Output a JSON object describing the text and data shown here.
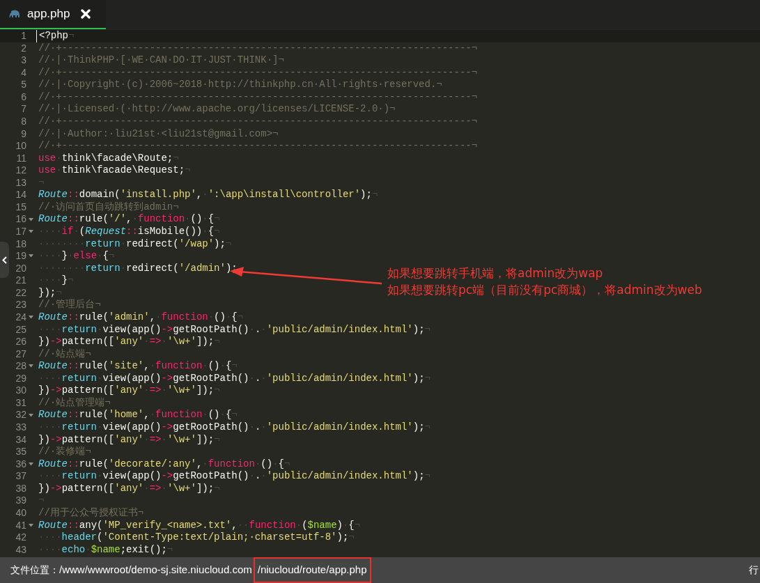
{
  "tabs": [
    {
      "label": "app.php",
      "selected": true
    }
  ],
  "lines": [
    {
      "number": "1",
      "foldable": false,
      "current": true,
      "tokens": [
        {
          "kind": "plain",
          "text": "<?php"
        },
        {
          "kind": "invisible",
          "text": "¬"
        }
      ]
    },
    {
      "number": "2",
      "foldable": false,
      "current": false,
      "tokens": [
        {
          "kind": "comment",
          "text": "//·+----------------------------------------------------------------------¬"
        }
      ]
    },
    {
      "number": "3",
      "foldable": false,
      "current": false,
      "tokens": [
        {
          "kind": "comment",
          "text": "//·|·ThinkPHP·[·WE·CAN·DO·IT·JUST·THINK·]¬"
        }
      ]
    },
    {
      "number": "4",
      "foldable": false,
      "current": false,
      "tokens": [
        {
          "kind": "comment",
          "text": "//·+----------------------------------------------------------------------¬"
        }
      ]
    },
    {
      "number": "5",
      "foldable": false,
      "current": false,
      "tokens": [
        {
          "kind": "comment",
          "text": "//·|·Copyright·(c)·2006~2018·http://thinkphp.cn·All·rights·reserved.¬"
        }
      ]
    },
    {
      "number": "6",
      "foldable": false,
      "current": false,
      "tokens": [
        {
          "kind": "comment",
          "text": "//·+----------------------------------------------------------------------¬"
        }
      ]
    },
    {
      "number": "7",
      "foldable": false,
      "current": false,
      "tokens": [
        {
          "kind": "comment",
          "text": "//·|·Licensed·(·http://www.apache.org/licenses/LICENSE-2.0·)¬"
        }
      ]
    },
    {
      "number": "8",
      "foldable": false,
      "current": false,
      "tokens": [
        {
          "kind": "comment",
          "text": "//·+----------------------------------------------------------------------¬"
        }
      ]
    },
    {
      "number": "9",
      "foldable": false,
      "current": false,
      "tokens": [
        {
          "kind": "comment",
          "text": "//·|·Author:·liu21st·<liu21st@gmail.com>¬"
        }
      ]
    },
    {
      "number": "10",
      "foldable": false,
      "current": false,
      "tokens": [
        {
          "kind": "comment",
          "text": "//·+----------------------------------------------------------------------¬"
        }
      ]
    },
    {
      "number": "11",
      "foldable": false,
      "current": false,
      "tokens": [
        {
          "kind": "keyword",
          "text": "use"
        },
        {
          "kind": "invisible",
          "text": "·"
        },
        {
          "kind": "plain",
          "text": "think\\facade\\Route;"
        },
        {
          "kind": "invisible",
          "text": "¬"
        }
      ]
    },
    {
      "number": "12",
      "foldable": false,
      "current": false,
      "tokens": [
        {
          "kind": "keyword",
          "text": "use"
        },
        {
          "kind": "invisible",
          "text": "·"
        },
        {
          "kind": "plain",
          "text": "think\\facade\\Request;"
        },
        {
          "kind": "invisible",
          "text": "¬"
        }
      ]
    },
    {
      "number": "13",
      "foldable": false,
      "current": false,
      "tokens": [
        {
          "kind": "invisible",
          "text": "¬"
        }
      ]
    },
    {
      "number": "14",
      "foldable": false,
      "current": false,
      "tokens": [
        {
          "kind": "class",
          "text": "Route"
        },
        {
          "kind": "keyword",
          "text": "::"
        },
        {
          "kind": "plain",
          "text": "domain("
        },
        {
          "kind": "string",
          "text": "'install.php'"
        },
        {
          "kind": "plain",
          "text": ","
        },
        {
          "kind": "invisible",
          "text": "·"
        },
        {
          "kind": "string",
          "text": "':\\app\\install\\controller'"
        },
        {
          "kind": "plain",
          "text": ");"
        },
        {
          "kind": "invisible",
          "text": "¬"
        }
      ]
    },
    {
      "number": "15",
      "foldable": false,
      "current": false,
      "tokens": [
        {
          "kind": "comment",
          "text": "//·访问首页自动跳转到admin¬"
        }
      ]
    },
    {
      "number": "16",
      "foldable": true,
      "current": false,
      "tokens": [
        {
          "kind": "class",
          "text": "Route"
        },
        {
          "kind": "keyword",
          "text": "::"
        },
        {
          "kind": "plain",
          "text": "rule("
        },
        {
          "kind": "string",
          "text": "'/'"
        },
        {
          "kind": "plain",
          "text": ","
        },
        {
          "kind": "invisible",
          "text": "·"
        },
        {
          "kind": "keyword",
          "text": "function"
        },
        {
          "kind": "invisible",
          "text": "·"
        },
        {
          "kind": "plain",
          "text": "()"
        },
        {
          "kind": "invisible",
          "text": "·"
        },
        {
          "kind": "plain",
          "text": "{"
        },
        {
          "kind": "invisible",
          "text": "¬"
        }
      ]
    },
    {
      "number": "17",
      "foldable": true,
      "current": false,
      "tokens": [
        {
          "kind": "invisible",
          "text": "····"
        },
        {
          "kind": "keyword",
          "text": "if"
        },
        {
          "kind": "invisible",
          "text": "·"
        },
        {
          "kind": "plain",
          "text": "("
        },
        {
          "kind": "class",
          "text": "Request"
        },
        {
          "kind": "keyword",
          "text": "::"
        },
        {
          "kind": "plain",
          "text": "isMobile())"
        },
        {
          "kind": "invisible",
          "text": "·"
        },
        {
          "kind": "plain",
          "text": "{"
        },
        {
          "kind": "invisible",
          "text": "¬"
        }
      ]
    },
    {
      "number": "18",
      "foldable": false,
      "current": false,
      "tokens": [
        {
          "kind": "invisible",
          "text": "········"
        },
        {
          "kind": "builtin",
          "text": "return"
        },
        {
          "kind": "invisible",
          "text": "·"
        },
        {
          "kind": "plain",
          "text": "redirect("
        },
        {
          "kind": "string",
          "text": "'/wap'"
        },
        {
          "kind": "plain",
          "text": ");"
        },
        {
          "kind": "invisible",
          "text": "¬"
        }
      ]
    },
    {
      "number": "19",
      "foldable": true,
      "current": false,
      "tokens": [
        {
          "kind": "invisible",
          "text": "····"
        },
        {
          "kind": "plain",
          "text": "}"
        },
        {
          "kind": "invisible",
          "text": "·"
        },
        {
          "kind": "keyword",
          "text": "else"
        },
        {
          "kind": "invisible",
          "text": "·"
        },
        {
          "kind": "plain",
          "text": "{"
        },
        {
          "kind": "invisible",
          "text": "¬"
        }
      ]
    },
    {
      "number": "20",
      "foldable": false,
      "current": false,
      "tokens": [
        {
          "kind": "invisible",
          "text": "········"
        },
        {
          "kind": "builtin",
          "text": "return"
        },
        {
          "kind": "invisible",
          "text": "·"
        },
        {
          "kind": "plain",
          "text": "redirect("
        },
        {
          "kind": "string",
          "text": "'/admin'"
        },
        {
          "kind": "plain",
          "text": ");"
        }
      ]
    },
    {
      "number": "21",
      "foldable": false,
      "current": false,
      "tokens": [
        {
          "kind": "invisible",
          "text": "····"
        },
        {
          "kind": "plain",
          "text": "}"
        },
        {
          "kind": "invisible",
          "text": "¬"
        }
      ]
    },
    {
      "number": "22",
      "foldable": false,
      "current": false,
      "tokens": [
        {
          "kind": "plain",
          "text": "});"
        },
        {
          "kind": "invisible",
          "text": "¬"
        }
      ]
    },
    {
      "number": "23",
      "foldable": false,
      "current": false,
      "tokens": [
        {
          "kind": "comment",
          "text": "//·管理后台¬"
        }
      ]
    },
    {
      "number": "24",
      "foldable": true,
      "current": false,
      "tokens": [
        {
          "kind": "class",
          "text": "Route"
        },
        {
          "kind": "keyword",
          "text": "::"
        },
        {
          "kind": "plain",
          "text": "rule("
        },
        {
          "kind": "string",
          "text": "'admin'"
        },
        {
          "kind": "plain",
          "text": ","
        },
        {
          "kind": "invisible",
          "text": "·"
        },
        {
          "kind": "keyword",
          "text": "function"
        },
        {
          "kind": "invisible",
          "text": "·"
        },
        {
          "kind": "plain",
          "text": "()"
        },
        {
          "kind": "invisible",
          "text": "·"
        },
        {
          "kind": "plain",
          "text": "{"
        },
        {
          "kind": "invisible",
          "text": "¬"
        }
      ]
    },
    {
      "number": "25",
      "foldable": false,
      "current": false,
      "tokens": [
        {
          "kind": "invisible",
          "text": "····"
        },
        {
          "kind": "builtin",
          "text": "return"
        },
        {
          "kind": "invisible",
          "text": "·"
        },
        {
          "kind": "plain",
          "text": "view(app()"
        },
        {
          "kind": "keyword",
          "text": "->"
        },
        {
          "kind": "plain",
          "text": "getRootPath()"
        },
        {
          "kind": "invisible",
          "text": "·"
        },
        {
          "kind": "plain",
          "text": "."
        },
        {
          "kind": "invisible",
          "text": "·"
        },
        {
          "kind": "string",
          "text": "'public/admin/index.html'"
        },
        {
          "kind": "plain",
          "text": ");"
        },
        {
          "kind": "invisible",
          "text": "¬"
        }
      ]
    },
    {
      "number": "26",
      "foldable": false,
      "current": false,
      "tokens": [
        {
          "kind": "plain",
          "text": "})"
        },
        {
          "kind": "keyword",
          "text": "->"
        },
        {
          "kind": "plain",
          "text": "pattern(["
        },
        {
          "kind": "string",
          "text": "'any'"
        },
        {
          "kind": "invisible",
          "text": "·"
        },
        {
          "kind": "keyword",
          "text": "=>"
        },
        {
          "kind": "invisible",
          "text": "·"
        },
        {
          "kind": "string",
          "text": "'\\w+'"
        },
        {
          "kind": "plain",
          "text": "]);"
        },
        {
          "kind": "invisible",
          "text": "¬"
        }
      ]
    },
    {
      "number": "27",
      "foldable": false,
      "current": false,
      "tokens": [
        {
          "kind": "comment",
          "text": "//·站点端¬"
        }
      ]
    },
    {
      "number": "28",
      "foldable": true,
      "current": false,
      "tokens": [
        {
          "kind": "class",
          "text": "Route"
        },
        {
          "kind": "keyword",
          "text": "::"
        },
        {
          "kind": "plain",
          "text": "rule("
        },
        {
          "kind": "string",
          "text": "'site'"
        },
        {
          "kind": "plain",
          "text": ","
        },
        {
          "kind": "invisible",
          "text": "·"
        },
        {
          "kind": "keyword",
          "text": "function"
        },
        {
          "kind": "invisible",
          "text": "·"
        },
        {
          "kind": "plain",
          "text": "()"
        },
        {
          "kind": "invisible",
          "text": "·"
        },
        {
          "kind": "plain",
          "text": "{"
        },
        {
          "kind": "invisible",
          "text": "¬"
        }
      ]
    },
    {
      "number": "29",
      "foldable": false,
      "current": false,
      "tokens": [
        {
          "kind": "invisible",
          "text": "····"
        },
        {
          "kind": "builtin",
          "text": "return"
        },
        {
          "kind": "invisible",
          "text": "·"
        },
        {
          "kind": "plain",
          "text": "view(app()"
        },
        {
          "kind": "keyword",
          "text": "->"
        },
        {
          "kind": "plain",
          "text": "getRootPath()"
        },
        {
          "kind": "invisible",
          "text": "·"
        },
        {
          "kind": "plain",
          "text": "."
        },
        {
          "kind": "invisible",
          "text": "·"
        },
        {
          "kind": "string",
          "text": "'public/admin/index.html'"
        },
        {
          "kind": "plain",
          "text": ");"
        },
        {
          "kind": "invisible",
          "text": "¬"
        }
      ]
    },
    {
      "number": "30",
      "foldable": false,
      "current": false,
      "tokens": [
        {
          "kind": "plain",
          "text": "})"
        },
        {
          "kind": "keyword",
          "text": "->"
        },
        {
          "kind": "plain",
          "text": "pattern(["
        },
        {
          "kind": "string",
          "text": "'any'"
        },
        {
          "kind": "invisible",
          "text": "·"
        },
        {
          "kind": "keyword",
          "text": "=>"
        },
        {
          "kind": "invisible",
          "text": "·"
        },
        {
          "kind": "string",
          "text": "'\\w+'"
        },
        {
          "kind": "plain",
          "text": "]);"
        },
        {
          "kind": "invisible",
          "text": "¬"
        }
      ]
    },
    {
      "number": "31",
      "foldable": false,
      "current": false,
      "tokens": [
        {
          "kind": "comment",
          "text": "//·站点管理端¬"
        }
      ]
    },
    {
      "number": "32",
      "foldable": true,
      "current": false,
      "tokens": [
        {
          "kind": "class",
          "text": "Route"
        },
        {
          "kind": "keyword",
          "text": "::"
        },
        {
          "kind": "plain",
          "text": "rule("
        },
        {
          "kind": "string",
          "text": "'home'"
        },
        {
          "kind": "plain",
          "text": ","
        },
        {
          "kind": "invisible",
          "text": "·"
        },
        {
          "kind": "keyword",
          "text": "function"
        },
        {
          "kind": "invisible",
          "text": "·"
        },
        {
          "kind": "plain",
          "text": "()"
        },
        {
          "kind": "invisible",
          "text": "·"
        },
        {
          "kind": "plain",
          "text": "{"
        },
        {
          "kind": "invisible",
          "text": "¬"
        }
      ]
    },
    {
      "number": "33",
      "foldable": false,
      "current": false,
      "tokens": [
        {
          "kind": "invisible",
          "text": "····"
        },
        {
          "kind": "builtin",
          "text": "return"
        },
        {
          "kind": "invisible",
          "text": "·"
        },
        {
          "kind": "plain",
          "text": "view(app()"
        },
        {
          "kind": "keyword",
          "text": "->"
        },
        {
          "kind": "plain",
          "text": "getRootPath()"
        },
        {
          "kind": "invisible",
          "text": "·"
        },
        {
          "kind": "plain",
          "text": "."
        },
        {
          "kind": "invisible",
          "text": "·"
        },
        {
          "kind": "string",
          "text": "'public/admin/index.html'"
        },
        {
          "kind": "plain",
          "text": ");"
        },
        {
          "kind": "invisible",
          "text": "¬"
        }
      ]
    },
    {
      "number": "34",
      "foldable": false,
      "current": false,
      "tokens": [
        {
          "kind": "plain",
          "text": "})"
        },
        {
          "kind": "keyword",
          "text": "->"
        },
        {
          "kind": "plain",
          "text": "pattern(["
        },
        {
          "kind": "string",
          "text": "'any'"
        },
        {
          "kind": "invisible",
          "text": "·"
        },
        {
          "kind": "keyword",
          "text": "=>"
        },
        {
          "kind": "invisible",
          "text": "·"
        },
        {
          "kind": "string",
          "text": "'\\w+'"
        },
        {
          "kind": "plain",
          "text": "]);"
        },
        {
          "kind": "invisible",
          "text": "¬"
        }
      ]
    },
    {
      "number": "35",
      "foldable": false,
      "current": false,
      "tokens": [
        {
          "kind": "comment",
          "text": "//·装修端¬"
        }
      ]
    },
    {
      "number": "36",
      "foldable": true,
      "current": false,
      "tokens": [
        {
          "kind": "class",
          "text": "Route"
        },
        {
          "kind": "keyword",
          "text": "::"
        },
        {
          "kind": "plain",
          "text": "rule("
        },
        {
          "kind": "string",
          "text": "'decorate/:any'"
        },
        {
          "kind": "plain",
          "text": ","
        },
        {
          "kind": "invisible",
          "text": "·"
        },
        {
          "kind": "keyword",
          "text": "function"
        },
        {
          "kind": "invisible",
          "text": "·"
        },
        {
          "kind": "plain",
          "text": "()"
        },
        {
          "kind": "invisible",
          "text": "·"
        },
        {
          "kind": "plain",
          "text": "{"
        },
        {
          "kind": "invisible",
          "text": "¬"
        }
      ]
    },
    {
      "number": "37",
      "foldable": false,
      "current": false,
      "tokens": [
        {
          "kind": "invisible",
          "text": "····"
        },
        {
          "kind": "builtin",
          "text": "return"
        },
        {
          "kind": "invisible",
          "text": "·"
        },
        {
          "kind": "plain",
          "text": "view(app()"
        },
        {
          "kind": "keyword",
          "text": "->"
        },
        {
          "kind": "plain",
          "text": "getRootPath()"
        },
        {
          "kind": "invisible",
          "text": "·"
        },
        {
          "kind": "plain",
          "text": "."
        },
        {
          "kind": "invisible",
          "text": "·"
        },
        {
          "kind": "string",
          "text": "'public/admin/index.html'"
        },
        {
          "kind": "plain",
          "text": ");"
        },
        {
          "kind": "invisible",
          "text": "¬"
        }
      ]
    },
    {
      "number": "38",
      "foldable": false,
      "current": false,
      "tokens": [
        {
          "kind": "plain",
          "text": "})"
        },
        {
          "kind": "keyword",
          "text": "->"
        },
        {
          "kind": "plain",
          "text": "pattern(["
        },
        {
          "kind": "string",
          "text": "'any'"
        },
        {
          "kind": "invisible",
          "text": "·"
        },
        {
          "kind": "keyword",
          "text": "=>"
        },
        {
          "kind": "invisible",
          "text": "·"
        },
        {
          "kind": "string",
          "text": "'\\w+'"
        },
        {
          "kind": "plain",
          "text": "]);"
        },
        {
          "kind": "invisible",
          "text": "¬"
        }
      ]
    },
    {
      "number": "39",
      "foldable": false,
      "current": false,
      "tokens": [
        {
          "kind": "invisible",
          "text": "¬"
        }
      ]
    },
    {
      "number": "40",
      "foldable": false,
      "current": false,
      "tokens": [
        {
          "kind": "comment",
          "text": "//用于公众号授权证书¬"
        }
      ]
    },
    {
      "number": "41",
      "foldable": true,
      "current": false,
      "tokens": [
        {
          "kind": "class",
          "text": "Route"
        },
        {
          "kind": "keyword",
          "text": "::"
        },
        {
          "kind": "plain",
          "text": "any("
        },
        {
          "kind": "string",
          "text": "'MP_verify_<name>.txt'"
        },
        {
          "kind": "plain",
          "text": ","
        },
        {
          "kind": "invisible",
          "text": "··"
        },
        {
          "kind": "keyword",
          "text": "function"
        },
        {
          "kind": "invisible",
          "text": "·"
        },
        {
          "kind": "plain",
          "text": "("
        },
        {
          "kind": "variable",
          "text": "$name"
        },
        {
          "kind": "plain",
          "text": ")"
        },
        {
          "kind": "invisible",
          "text": "·"
        },
        {
          "kind": "plain",
          "text": "{"
        },
        {
          "kind": "invisible",
          "text": "¬"
        }
      ]
    },
    {
      "number": "42",
      "foldable": false,
      "current": false,
      "tokens": [
        {
          "kind": "invisible",
          "text": "····"
        },
        {
          "kind": "builtin",
          "text": "header"
        },
        {
          "kind": "plain",
          "text": "("
        },
        {
          "kind": "string",
          "text": "'Content-Type:text/plain;·charset=utf-8'"
        },
        {
          "kind": "plain",
          "text": ");"
        },
        {
          "kind": "invisible",
          "text": "¬"
        }
      ]
    },
    {
      "number": "43",
      "foldable": false,
      "current": false,
      "tokens": [
        {
          "kind": "invisible",
          "text": "····"
        },
        {
          "kind": "builtin",
          "text": "echo"
        },
        {
          "kind": "invisible",
          "text": "·"
        },
        {
          "kind": "variable",
          "text": "$name"
        },
        {
          "kind": "plain",
          "text": ";exit();"
        },
        {
          "kind": "invisible",
          "text": "¬"
        }
      ]
    }
  ],
  "annotation": {
    "lines": [
      "如果想要跳转手机端，将admin改为wap",
      "如果想要跳转pc端（目前没有pc商城），将admin改为web"
    ]
  },
  "status_bar": {
    "label": "文件位置：",
    "path": "/www/wwwroot/demo-sj.site.niucloud.com",
    "highlighted_path": "/niucloud/route/app.php",
    "right_text": "行"
  }
}
